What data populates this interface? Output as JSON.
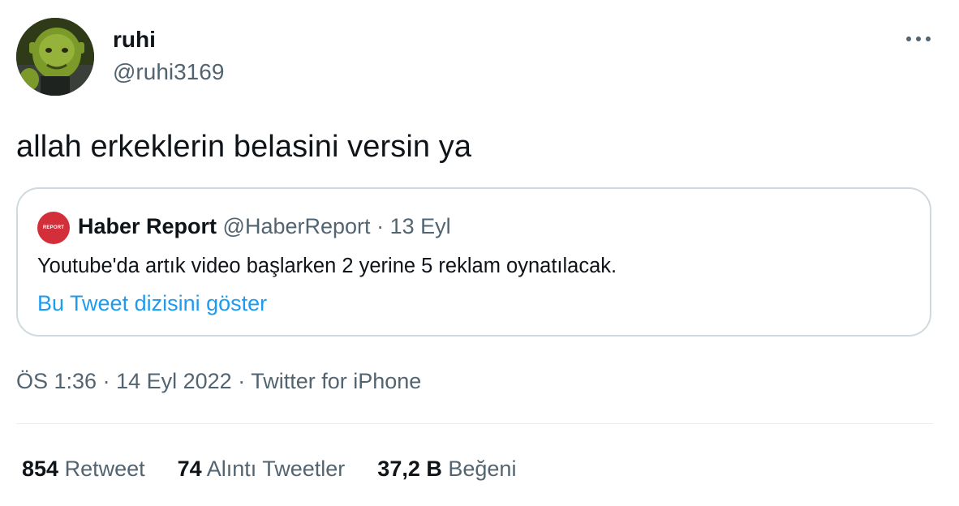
{
  "author": {
    "display_name": "ruhi",
    "handle": "@ruhi3169",
    "avatar_icon": "shrek-avatar-icon"
  },
  "more_icon": "more-horizontal-icon",
  "tweet": {
    "text": "allah erkeklerin belasini versin ya"
  },
  "quoted_tweet": {
    "avatar_text": "REPORT",
    "avatar_color": "#d32f3a",
    "display_name": "Haber Report",
    "handle": "@HaberReport",
    "separator": "·",
    "date": "13 Eyl",
    "text": "Youtube'da artık video başlarken 2 yerine 5 reklam oynatılacak.",
    "show_thread_link": "Bu Tweet dizisini göster"
  },
  "meta": {
    "time": "ÖS 1:36",
    "separator": "·",
    "date": "14 Eyl 2022",
    "source": "Twitter for iPhone"
  },
  "stats": [
    {
      "value": "854",
      "label": "Retweet"
    },
    {
      "value": "74",
      "label": "Alıntı Tweetler"
    },
    {
      "value": "37,2 B",
      "label": "Beğeni"
    }
  ],
  "colors": {
    "link_blue": "#1d9bf0",
    "secondary_text": "#536471",
    "border": "#cfd9de"
  }
}
